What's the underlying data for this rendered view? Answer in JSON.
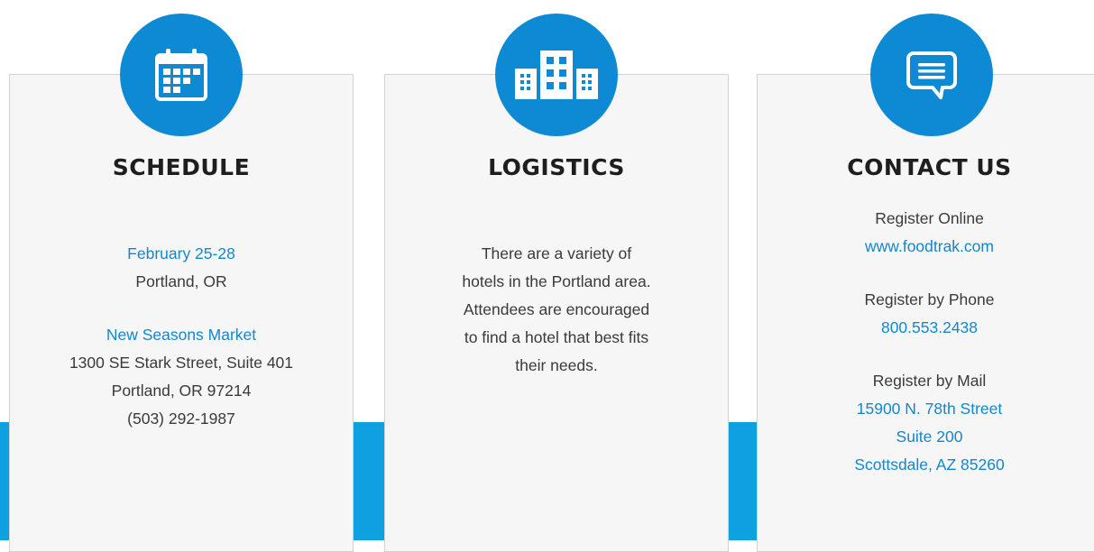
{
  "colors": {
    "accent": "#0e8ad4",
    "band": "#0ea0e0",
    "link": "#1288cc",
    "card_bg": "#f6f6f6",
    "heading": "#1e1e1e",
    "text": "#3a3a3a"
  },
  "schedule": {
    "icon": "calendar-icon",
    "title": "SCHEDULE",
    "dates": "February 25-28",
    "city": "Portland, OR",
    "venue_name": "New Seasons Market",
    "venue_street": "1300 SE Stark Street, Suite 401",
    "venue_city": "Portland, OR 97214",
    "venue_phone": "(503) 292-1987"
  },
  "logistics": {
    "icon": "buildings-icon",
    "title": "LOGISTICS",
    "lines": [
      "There are a variety of",
      "hotels in the Portland area.",
      "Attendees are encouraged",
      "to find a hotel that best fits",
      "their needs."
    ]
  },
  "contact": {
    "icon": "chat-bubble-icon",
    "title": "CONTACT US",
    "online_label": "Register Online",
    "online_url": "www.foodtrak.com",
    "phone_label": "Register by Phone",
    "phone_number": "800.553.2438",
    "mail_label": "Register by Mail",
    "mail_line1": "15900 N. 78th Street",
    "mail_line2": "Suite 200",
    "mail_line3": "Scottsdale, AZ 85260"
  }
}
